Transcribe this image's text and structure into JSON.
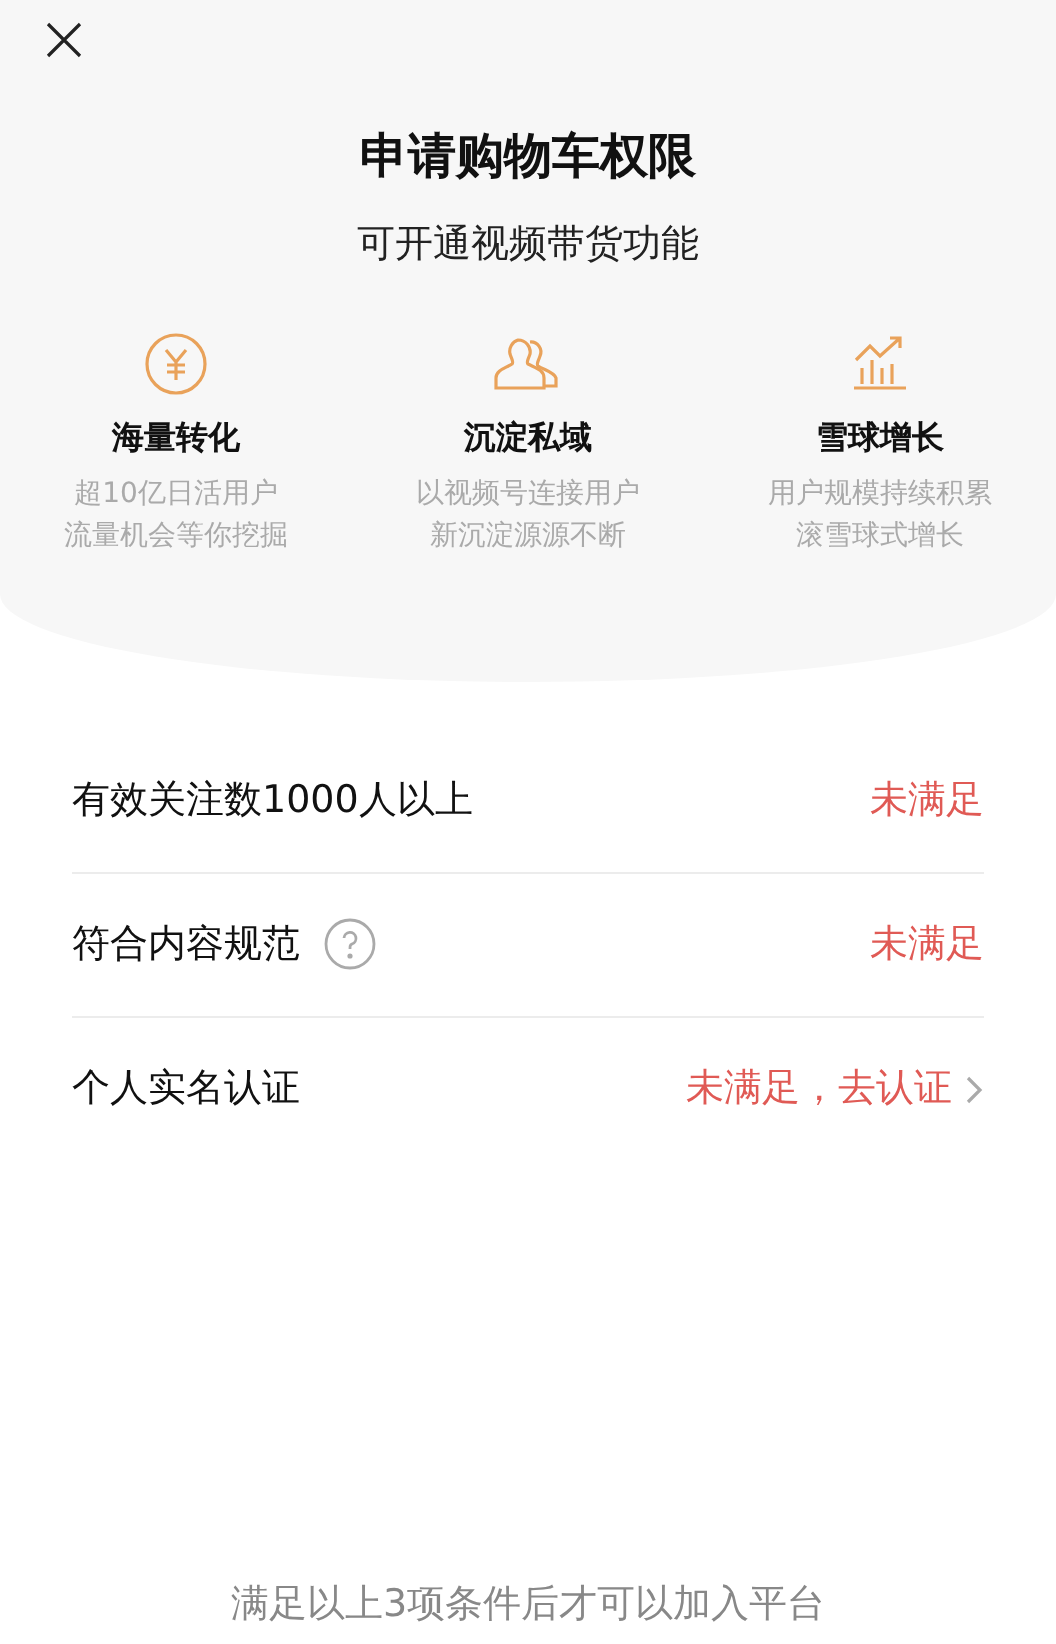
{
  "title": "申请购物车权限",
  "subtitle": "可开通视频带货功能",
  "features": [
    {
      "title": "海量转化",
      "lines": [
        "超10亿日活用户",
        "流量机会等你挖掘"
      ]
    },
    {
      "title": "沉淀私域",
      "lines": [
        "以视频号连接用户",
        "新沉淀源源不断"
      ]
    },
    {
      "title": "雪球增长",
      "lines": [
        "用户规模持续积累",
        "滚雪球式增长"
      ]
    }
  ],
  "requirements": [
    {
      "kind": "plain",
      "label": "有效关注数1000人以上",
      "status": "未满足"
    },
    {
      "kind": "help",
      "label": "符合内容规范",
      "status": "未满足"
    },
    {
      "kind": "link",
      "label": "个人实名认证",
      "status": "未满足，去认证"
    }
  ],
  "footer": "满足以上3项条件后才可以加入平台"
}
